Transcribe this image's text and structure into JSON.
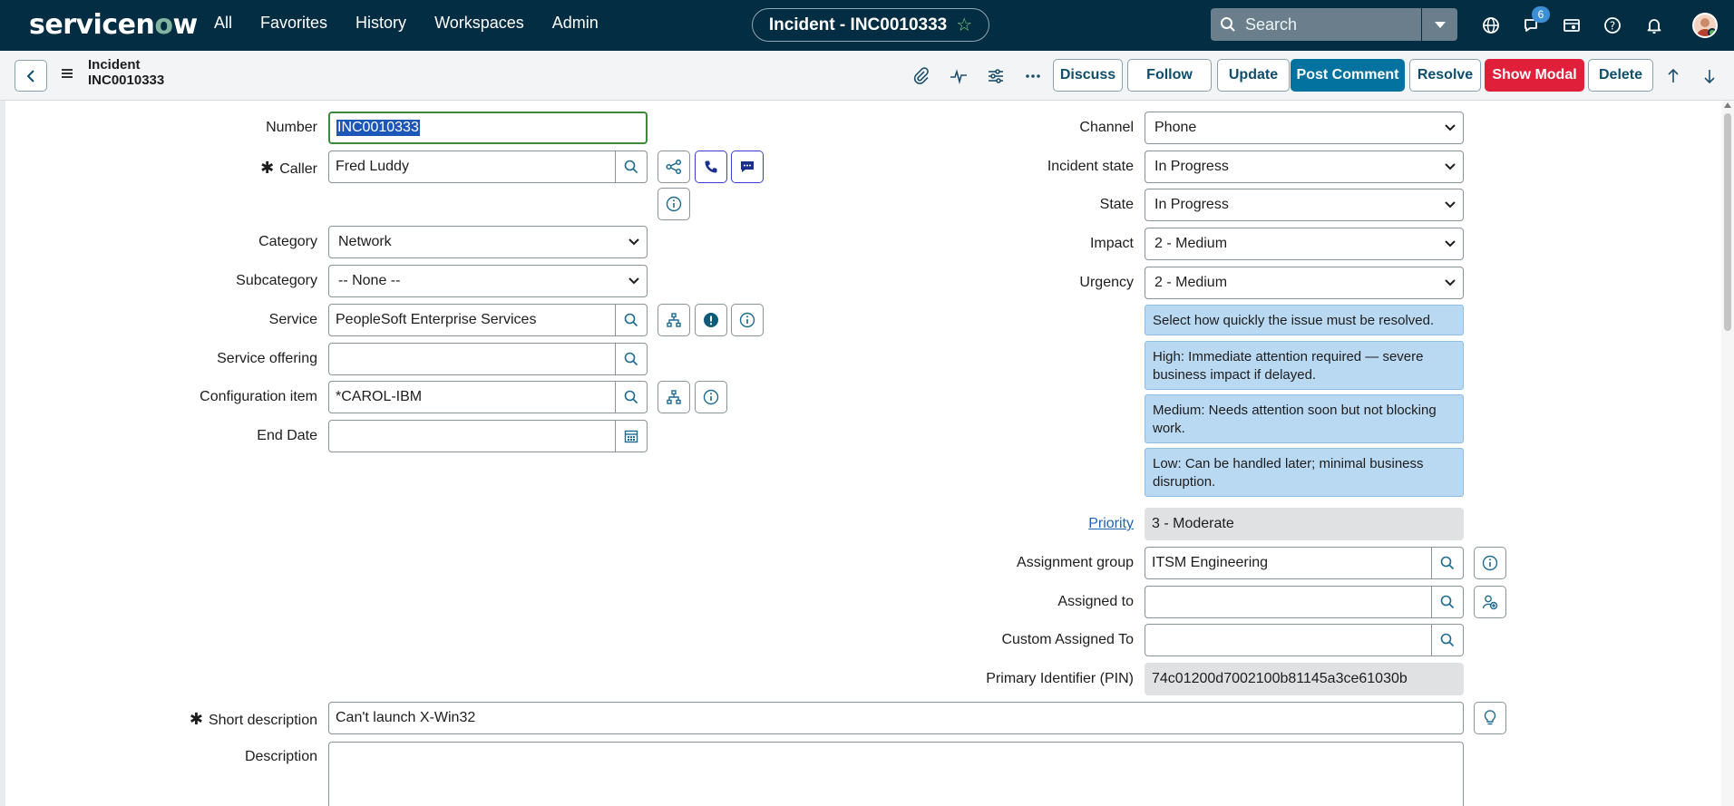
{
  "nav": {
    "logo_part1": "servicen",
    "logo_o": "o",
    "logo_part2": "w",
    "links": [
      "All",
      "Favorites",
      "History",
      "Workspaces",
      "Admin"
    ],
    "record_pill": "Incident - INC0010333",
    "search_placeholder": "Search",
    "chat_badge": "6",
    "icons": [
      "globe-icon",
      "chat-icon",
      "app-switch-icon",
      "help-icon",
      "bell-icon"
    ]
  },
  "header": {
    "title_line1": "Incident",
    "title_line2": "INC0010333",
    "buttons": {
      "discuss": "Discuss",
      "follow": "Follow",
      "update": "Update",
      "post_comment": "Post Comment",
      "resolve": "Resolve",
      "show_modal": "Show Modal",
      "delete": "Delete"
    }
  },
  "form": {
    "left": {
      "number_label": "Number",
      "number_value": "INC0010333",
      "caller_label": "Caller",
      "caller_value": "Fred Luddy",
      "category_label": "Category",
      "category_value": "Network",
      "subcategory_label": "Subcategory",
      "subcategory_value": "-- None --",
      "service_label": "Service",
      "service_value": "PeopleSoft Enterprise Services",
      "service_offering_label": "Service offering",
      "service_offering_value": "",
      "ci_label": "Configuration item",
      "ci_value": "*CAROL-IBM",
      "end_date_label": "End Date",
      "end_date_value": ""
    },
    "right": {
      "channel_label": "Channel",
      "channel_value": "Phone",
      "incident_state_label": "Incident state",
      "incident_state_value": "In Progress",
      "state_label": "State",
      "state_value": "In Progress",
      "impact_label": "Impact",
      "impact_value": "2 - Medium",
      "urgency_label": "Urgency",
      "urgency_value": "2 - Medium",
      "hints": [
        "Select how quickly the issue must be resolved.",
        "High: Immediate attention required — severe business impact if delayed.",
        "Medium: Needs attention soon but not blocking work.",
        "Low: Can be handled later; minimal business disruption."
      ],
      "priority_label": "Priority",
      "priority_value": "3 - Moderate",
      "assignment_group_label": "Assignment group",
      "assignment_group_value": "ITSM Engineering",
      "assigned_to_label": "Assigned to",
      "assigned_to_value": "",
      "custom_assigned_label": "Custom Assigned To",
      "custom_assigned_value": "",
      "pin_label": "Primary Identifier (PIN)",
      "pin_value": "74c01200d7002100b81145a3ce61030b"
    },
    "short_description_label": "Short description",
    "short_description_value": "Can't launch X-Win32",
    "description_label": "Description"
  }
}
